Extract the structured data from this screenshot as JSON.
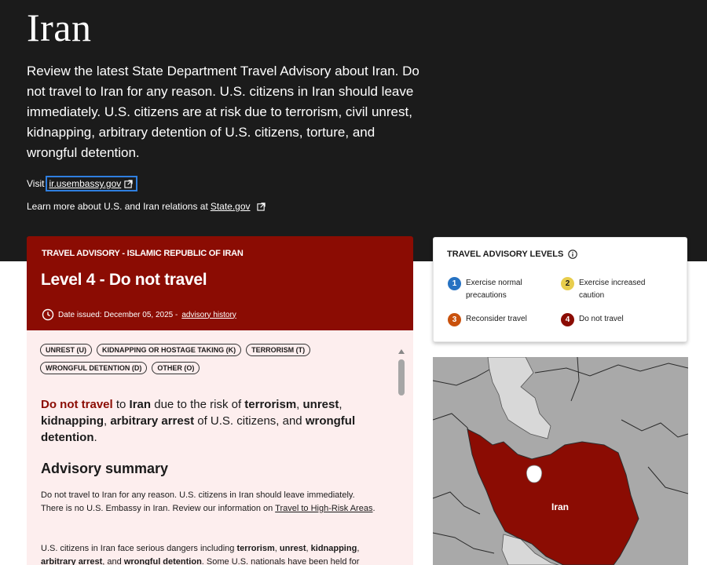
{
  "hero": {
    "title": "Iran",
    "intro": "Review the latest State Department Travel Advisory about Iran. Do not travel to Iran for any reason. U.S. citizens in Iran should leave immediately. U.S. citizens are at risk due to terrorism, civil unrest, kidnapping, arbitrary detention of U.S. citizens, torture, and wrongful detention.",
    "visit_prefix": "Visit",
    "visit_link": "ir.usembassy.gov",
    "learn_prefix": "Learn more about U.S. and Iran relations at",
    "learn_link": "State.gov"
  },
  "advisory": {
    "eyebrow": "TRAVEL ADVISORY - ISLAMIC REPUBLIC OF IRAN",
    "level": "Level 4 - Do not travel",
    "date_text": "Date issued: December 05, 2025 -",
    "history_link": "advisory history",
    "tags": [
      "UNREST (U)",
      "KIDNAPPING OR HOSTAGE TAKING (K)",
      "TERRORISM (T)",
      "WRONGFUL DETENTION (D)",
      "OTHER (O)"
    ],
    "lead": {
      "do_not_travel": "Do not travel",
      "t1": " to ",
      "iran": "Iran",
      "t2": " due to the risk of ",
      "terrorism": "terrorism",
      "t3": ", ",
      "unrest": "unrest",
      "t4": ", ",
      "kidnapping": "kidnapping",
      "t5": ", ",
      "arbitrary_arrest": "arbitrary arrest",
      "t6": " of U.S. citizens, and ",
      "wrongful_detention": "wrongful detention",
      "t7": "."
    },
    "summary_title": "Advisory summary",
    "para1_text": "Do not travel to Iran for any reason. U.S. citizens in Iran should leave immediately. There is no U.S. Embassy in Iran. Review our information on ",
    "para1_link": "Travel to High-Risk Areas",
    "para1_end": ".",
    "para2": {
      "t1": "U.S. citizens in Iran face serious dangers including ",
      "terrorism": "terrorism",
      "t2": ", ",
      "unrest": "unrest",
      "t3": ", ",
      "kidnapping": "kidnapping",
      "t4": ", ",
      "arbitrary_arrest": "arbitrary arrest",
      "t5": ", and ",
      "wrongful_detention": "wrongful detention",
      "t6": ". Some U.S. nationals have been held for"
    }
  },
  "levels": {
    "title": "TRAVEL ADVISORY LEVELS",
    "items": [
      {
        "num": "1",
        "label": "Exercise normal precautions",
        "color": "#2672c2"
      },
      {
        "num": "2",
        "label": "Exercise increased caution",
        "color": "#e8cd4d"
      },
      {
        "num": "3",
        "label": "Reconsider travel",
        "color": "#c9510c"
      },
      {
        "num": "4",
        "label": "Do not travel",
        "color": "#8b0c03"
      }
    ]
  },
  "map": {
    "country_label": "Iran",
    "highlight_color": "#8b0c03"
  },
  "colors": {
    "hero_bg": "#1b1b1b",
    "advisory_red": "#8b0c03",
    "advisory_body_bg": "#fdeeee",
    "focus_ring": "#2f7fe0"
  }
}
